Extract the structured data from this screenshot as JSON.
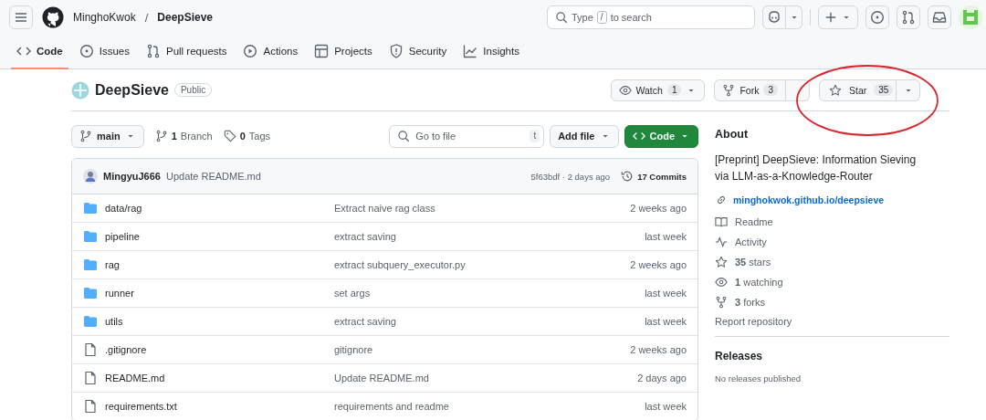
{
  "header": {
    "owner": "MinghoKwok",
    "separator": "/",
    "repo": "DeepSieve",
    "search": {
      "placeholder_before": "Type",
      "key": "/",
      "placeholder_after": "to search"
    }
  },
  "tabs": [
    {
      "label": "Code",
      "selected": true
    },
    {
      "label": "Issues",
      "selected": false
    },
    {
      "label": "Pull requests",
      "selected": false
    },
    {
      "label": "Actions",
      "selected": false
    },
    {
      "label": "Projects",
      "selected": false
    },
    {
      "label": "Security",
      "selected": false
    },
    {
      "label": "Insights",
      "selected": false
    }
  ],
  "repo": {
    "name": "DeepSieve",
    "visibility": "Public",
    "watch": {
      "label": "Watch",
      "count": "1"
    },
    "fork": {
      "label": "Fork",
      "count": "3"
    },
    "star": {
      "label": "Star",
      "count": "35",
      "starred": false
    }
  },
  "highlight": {
    "kind": "ellipse"
  },
  "toolbar": {
    "branch": "main",
    "branches_count": "1",
    "branches_label": "Branch",
    "tags_count": "0",
    "tags_label": "Tags",
    "go_to_file": {
      "placeholder": "Go to file",
      "key": "t"
    },
    "add_file": "Add file",
    "code": "Code"
  },
  "latest_commit": {
    "author": "MingyuJ666",
    "message": "Update README.md",
    "hash_time": "5f63bdf · 2 days ago",
    "commits": "17 Commits"
  },
  "files": [
    {
      "kind": "folder",
      "name": "data/rag",
      "message": "Extract naive rag class",
      "time": "2 weeks ago"
    },
    {
      "kind": "folder",
      "name": "pipeline",
      "message": "extract saving",
      "time": "last week"
    },
    {
      "kind": "folder",
      "name": "rag",
      "message": "extract subquery_executor.py",
      "time": "2 weeks ago"
    },
    {
      "kind": "folder",
      "name": "runner",
      "message": "set args",
      "time": "last week"
    },
    {
      "kind": "folder",
      "name": "utils",
      "message": "extract saving",
      "time": "last week"
    },
    {
      "kind": "file",
      "name": ".gitignore",
      "message": "gitignore",
      "time": "2 weeks ago"
    },
    {
      "kind": "file",
      "name": "README.md",
      "message": "Update README.md",
      "time": "2 days ago"
    },
    {
      "kind": "file",
      "name": "requirements.txt",
      "message": "requirements and readme",
      "time": "last week"
    }
  ],
  "about": {
    "title": "About",
    "description": "[Preprint] DeepSieve: Information Sieving via LLM-as-a-Knowledge-Router",
    "website": "minghokwok.github.io/deepsieve",
    "items": [
      "Readme",
      "Activity",
      "**35** stars",
      "**1** watching",
      "**3** forks"
    ],
    "report": "Report repository"
  },
  "releases": {
    "title": "Releases",
    "note": "No releases published"
  }
}
